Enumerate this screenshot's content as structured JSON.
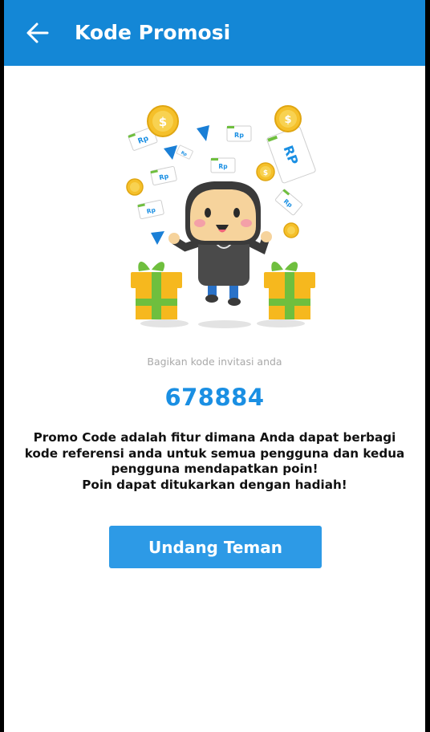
{
  "header": {
    "back_icon": "arrow-left-icon",
    "title": "Kode Promosi"
  },
  "illustration": {
    "rp_labels": [
      "Rp",
      "Rp",
      "Rp",
      "Rp",
      "Rp",
      "Rp",
      "Rp",
      "RP"
    ],
    "coin_symbol": "$"
  },
  "referral": {
    "caption": "Bagikan kode invitasi anda",
    "code": "678884"
  },
  "description": {
    "line1": "Promo Code adalah fitur dimana Anda dapat berbagi",
    "line2": "kode referensi anda untuk semua pengguna dan kedua",
    "line3": "pengguna mendapatkan poin!",
    "line4": "Poin dapat ditukarkan dengan hadiah!"
  },
  "cta": {
    "label": "Undang Teman"
  },
  "colors": {
    "appbar": "#1487d6",
    "code": "#1a8fe3",
    "button": "#2d9ae6",
    "coin": "#f5c02a",
    "gift": "#f6b81e",
    "ribbon": "#6fbf3e"
  }
}
